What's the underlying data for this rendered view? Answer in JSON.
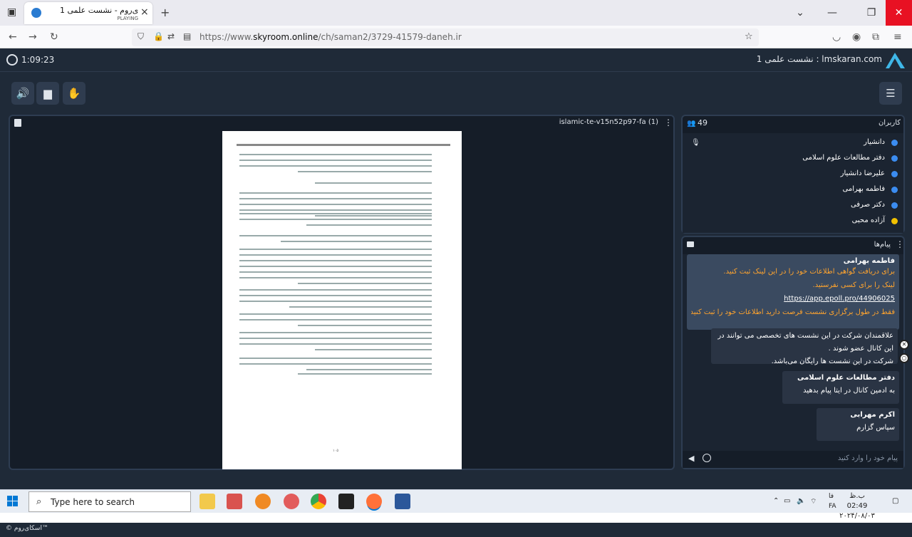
{
  "browser": {
    "tab_title": "اسکای‌روم - نشست علمی 1",
    "tab_subtitle": "PLAYING",
    "url_prefix": "https://www.",
    "url_domain": "skyroom.online",
    "url_path": "/ch/saman2/3729-41579-daneh.ir"
  },
  "app": {
    "timer": "1:09:23",
    "room_title": "lmskaran.com : نشست علمی 1",
    "footer": "© اسکای‌روم™"
  },
  "presentation": {
    "title": "islamic-te-v15n52p97-fa (1)",
    "page_number": "۱۰۵"
  },
  "users": {
    "label": "کاربران",
    "count": "49",
    "list": [
      {
        "name": "دانشیار",
        "color": "#3b8cf0",
        "mic": true
      },
      {
        "name": "دفتر مطالعات علوم اسلامی",
        "color": "#3b8cf0",
        "mic": false
      },
      {
        "name": "علیرضا دانشیار",
        "color": "#3b8cf0",
        "mic": false
      },
      {
        "name": "فاطمه بهرامی",
        "color": "#3b8cf0",
        "mic": false
      },
      {
        "name": "دکتر صرفی",
        "color": "#3b8cf0",
        "mic": false
      },
      {
        "name": "آزاده محبی",
        "color": "#f0c000",
        "mic": false
      }
    ]
  },
  "chat": {
    "label": "پیام‌ها",
    "pinned": {
      "name": "فاطمه بهرامی",
      "line1": "برای دریافت گواهی اطلاعات خود را در این لینک ثبت کنید.",
      "line2": "لینک را برای کسی نفرستید.",
      "link": "https://app.epoll.pro/44906025",
      "line3": "فقط در طول برگزاری نشست فرصت دارید اطلاعات خود را ثبت کنید"
    },
    "pinned_cont": {
      "line1": "علاقمندان شرکت در این نشست های تخصصی می توانند در این کانال عضو شوند .",
      "line2": "شرکت در این نشست ها رایگان می‌باشد."
    },
    "messages": [
      {
        "name": "دفتر مطالعات علوم اسلامی",
        "text": "به ادمین کانال در ایتا پیام بدهید"
      },
      {
        "name": "اکرم مهرابی",
        "text": "سپاس گزارم"
      }
    ],
    "placeholder": "پیام خود را وارد کنید"
  },
  "taskbar": {
    "search_placeholder": "Type here to search",
    "time": "ب.ظ 02:49",
    "date": "۲۰۲۴/۰۸/۰۳",
    "lang_top": "فا",
    "lang_bottom": "FA"
  }
}
